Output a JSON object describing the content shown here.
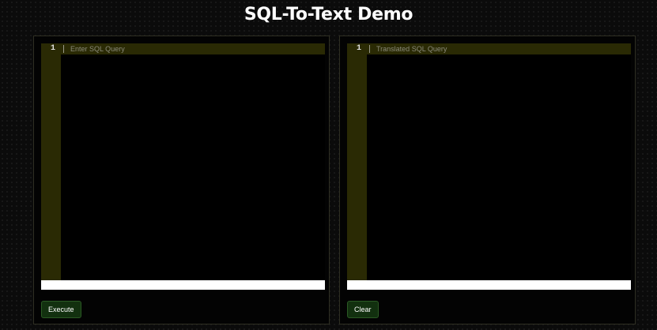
{
  "page": {
    "title": "SQL-To-Text Demo"
  },
  "input_panel": {
    "line_number": "1",
    "placeholder": "Enter SQL Query",
    "value": "",
    "execute_label": "Execute"
  },
  "output_panel": {
    "line_number": "1",
    "placeholder": "Translated SQL Query",
    "value": "",
    "clear_label": "Clear"
  },
  "colors": {
    "background": "#0b0b0b",
    "gutter": "#2a2a04",
    "button": "#12300f",
    "text": "#ffffff"
  }
}
